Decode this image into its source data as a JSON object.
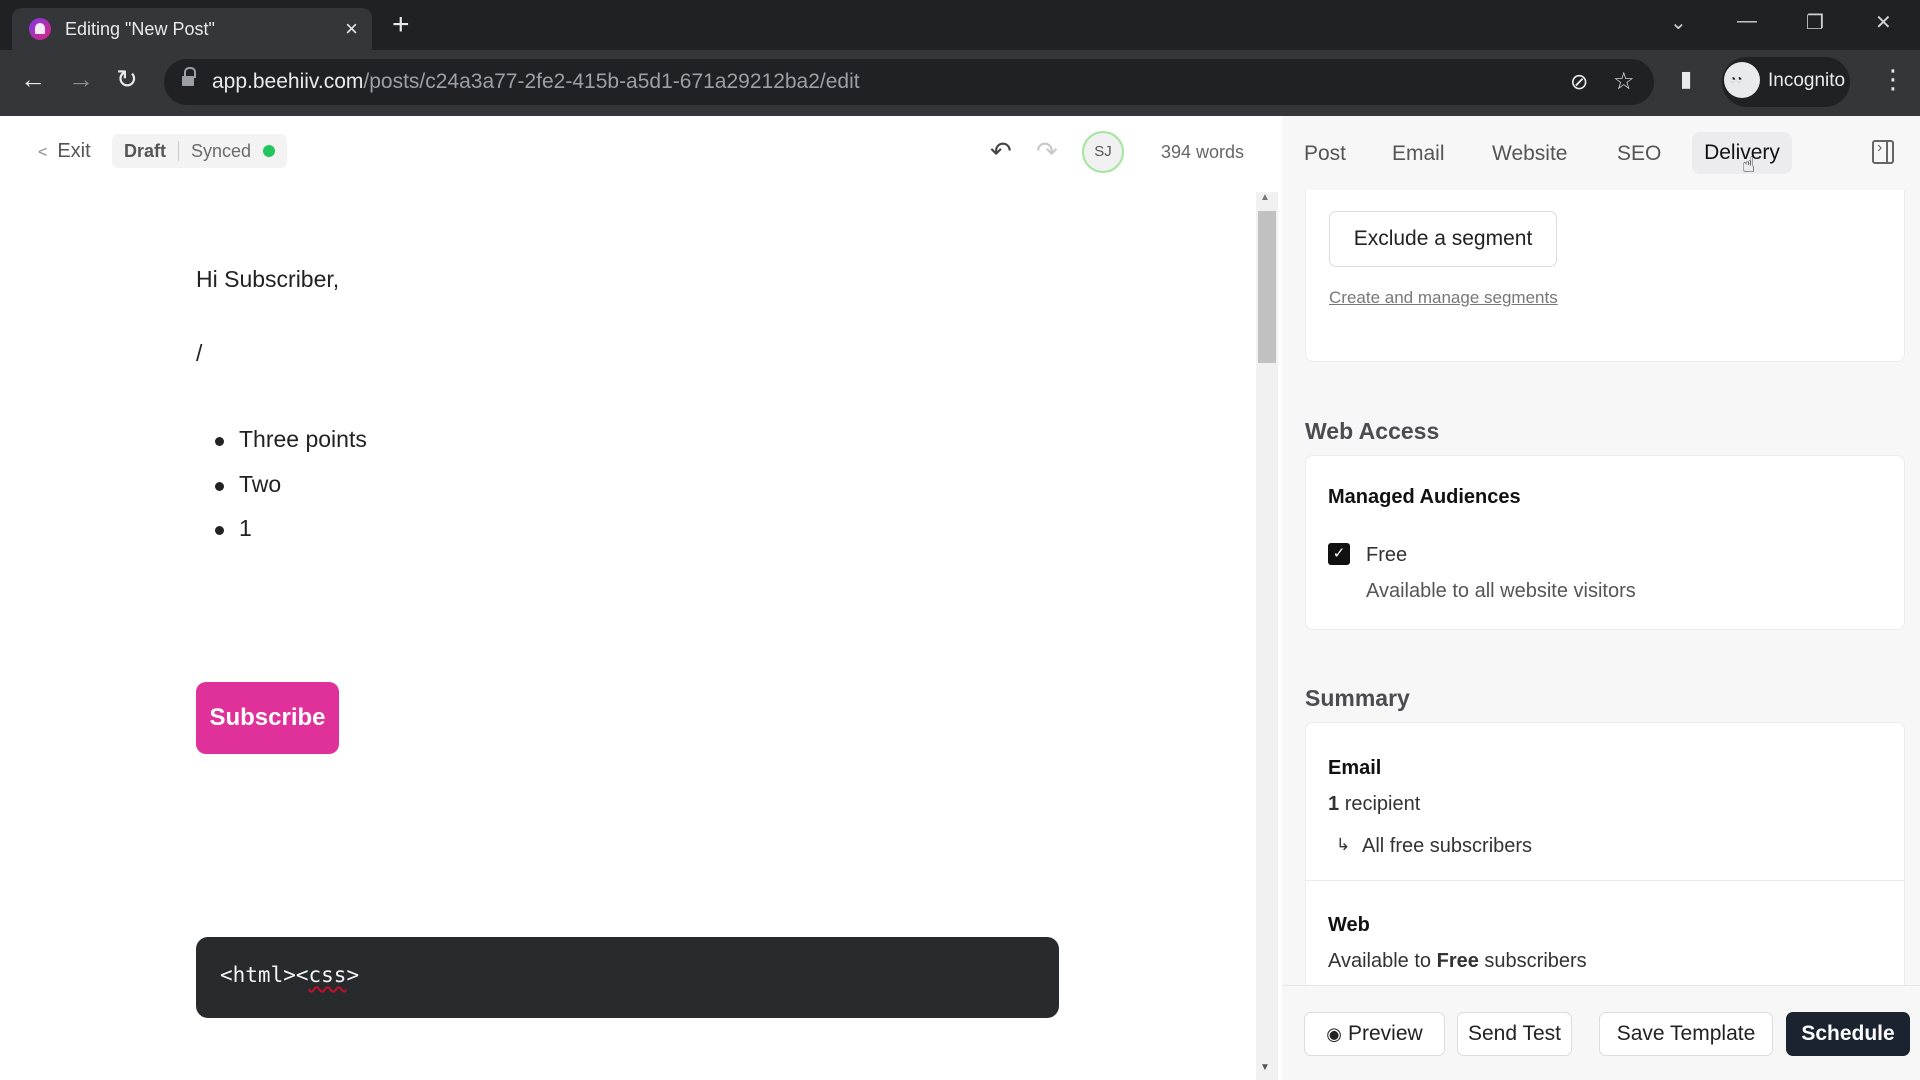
{
  "browser": {
    "tab_title": "Editing \"New Post\"",
    "url_host": "app.beehiiv.com",
    "url_path": "/posts/c24a3a77-2fe2-415b-a5d1-671a29212ba2/edit",
    "profile_label": "Incognito",
    "icons": {
      "tab_close": "×",
      "new_tab": "+",
      "back": "←",
      "forward": "→",
      "reload": "↻",
      "tab_search": "⌄",
      "minimize": "—",
      "restore": "❐",
      "window_close": "✕",
      "eye_off": "⊘",
      "star": "☆",
      "side_panel": "▮",
      "menu": "⋮"
    }
  },
  "editor_header": {
    "exit_label": "Exit",
    "draft_label": "Draft",
    "synced_label": "Synced",
    "undo_icon": "↶",
    "redo_icon": "↷",
    "avatar_initials": "SJ",
    "word_count": "394 words"
  },
  "content": {
    "greeting": "Hi Subscriber,",
    "slash": "/",
    "bullets": [
      "Three points",
      "Two",
      "1"
    ],
    "subscribe_button": "Subscribe",
    "code_before": "<html><",
    "code_misspelled": "css",
    "code_after": ">"
  },
  "panel": {
    "tabs": [
      "Post",
      "Email",
      "Website",
      "SEO",
      "Delivery"
    ],
    "active_tab": "Delivery",
    "segments": {
      "exclude_button": "Exclude a segment",
      "manage_link": "Create and manage segments"
    },
    "web_access": {
      "heading": "Web Access",
      "subheading": "Managed Audiences",
      "option_label": "Free",
      "option_checked": true,
      "option_desc": "Available to all website visitors"
    },
    "summary": {
      "heading": "Summary",
      "email_label": "Email",
      "recipient_count": "1",
      "recipient_word": "recipient",
      "arrow": "↳",
      "audience": "All free subscribers",
      "web_label": "Web",
      "web_prefix": "Available to",
      "web_tier": "Free",
      "web_suffix": "subscribers"
    },
    "footer": {
      "preview": "Preview",
      "send_test": "Send Test",
      "save_template": "Save Template",
      "schedule": "Schedule"
    }
  },
  "colors": {
    "subscribe": "#e0309a",
    "schedule": "#1b2230",
    "synced_dot": "#22c55e"
  }
}
